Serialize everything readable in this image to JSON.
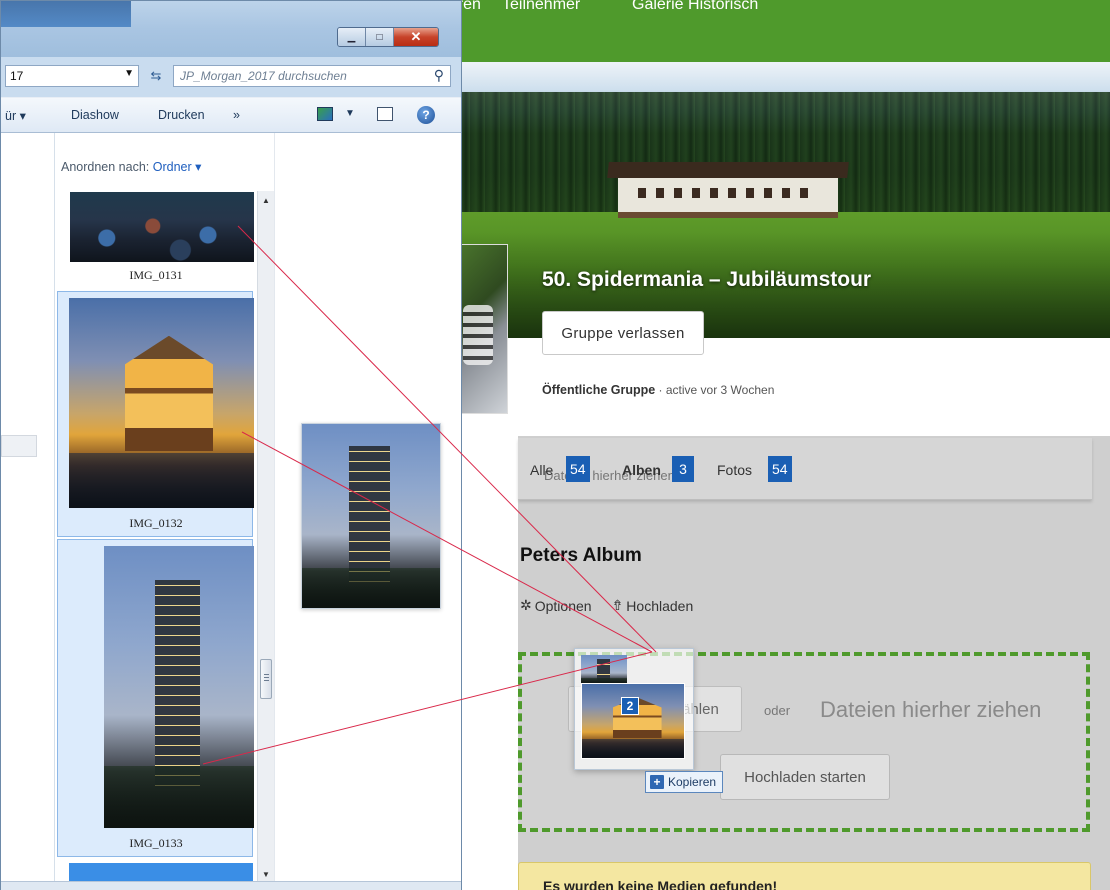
{
  "website": {
    "nav": [
      "Touren",
      "Teilnehmer",
      "Galerie Historisch"
    ],
    "group_title": "50. Spidermania – Jubiläumstour",
    "leave_button": "Gruppe verlassen",
    "group_type": "Öffentliche Gruppe",
    "group_activity": " · active vor 3 Wochen",
    "filter_tabs": [
      {
        "label": "Alle",
        "count": "54"
      },
      {
        "label": "Alben",
        "count": "3"
      },
      {
        "label": "Fotos",
        "count": "54"
      }
    ],
    "filter_drop_hint": "Dateien hierher ziehen",
    "album_title": "Peters Album",
    "album_actions": {
      "options": "Optionen",
      "upload": "Hochladen"
    },
    "dropzone": {
      "choose_button": "Dateien auswählen",
      "or": "oder",
      "drag_hint": "Dateien hierher ziehen",
      "start_button": "Hochladen starten"
    },
    "alert": "Es wurden keine Medien gefunden!",
    "colors": {
      "nav_green": "#4f9a2c",
      "badge_blue": "#1a5fb4",
      "dropzone_border": "#4f9a2c",
      "alert_bg": "#f4e7a1"
    }
  },
  "explorer": {
    "address_value": "17",
    "search_placeholder": "JP_Morgan_2017 durchsuchen",
    "toolbar": {
      "organize_partial": "ür ▾",
      "slideshow": "Diashow",
      "print": "Drucken",
      "more": "»"
    },
    "arrange_label": "Anordnen nach:",
    "arrange_value": "Ordner ▾",
    "files": [
      {
        "name": "IMG_0131",
        "selected": false,
        "picture": "crowd"
      },
      {
        "name": "IMG_0132",
        "selected": true,
        "picture": "opera"
      },
      {
        "name": "IMG_0133",
        "selected": true,
        "picture": "tower"
      }
    ],
    "preview_picture": "tower",
    "window_controls": [
      "minimize-icon",
      "maximize-icon",
      "close-icon"
    ]
  },
  "drag": {
    "count": "2",
    "copy_label": "Kopieren"
  }
}
